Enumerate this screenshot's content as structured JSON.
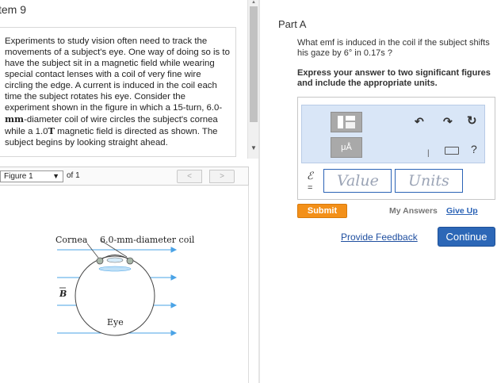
{
  "item": {
    "title": "tem 9"
  },
  "problem": {
    "line1": "Experiments to study vision often need to track the movements of a subject's eye. One way of doing so is to have the subject sit in a magnetic field while wearing special contact lenses with a coil of very fine wire circling the edge. A current is induced in the coil each time the subject rotates his eye. Consider the experiment shown in the figure in which a 15-turn, 6.0-",
    "unit_mm": "mm",
    "line2": "-diameter coil of wire circles the subject's cornea while a 1.0",
    "unit_T": "T",
    "line3": " magnetic field is directed as shown. The subject begins by looking straight ahead."
  },
  "figure_nav": {
    "select_value": "Figure 1",
    "of_text": "of 1",
    "prev": "<",
    "next": ">"
  },
  "figure": {
    "cornea_label": "Cornea",
    "coil_label": "6.0-mm-diameter coil",
    "b_label": "B",
    "eye_label": "Eye"
  },
  "part": {
    "label": "Part A",
    "question": "What emf is induced in the coil if the subject shifts his gaze by 6° in 0.17s ?",
    "instruction": "Express your answer to two significant figures and include the appropriate units."
  },
  "answer": {
    "var_symbol": "ℰ",
    "eq": "=",
    "value_placeholder": "Value",
    "units_placeholder": "Units",
    "unit_tool": "μÅ"
  },
  "actions": {
    "submit": "Submit",
    "my_answers": "My Answers",
    "give_up": "Give Up",
    "feedback": "Provide Feedback",
    "continue": "Continue"
  },
  "colors": {
    "submit": "#f39019",
    "continue": "#2c67b7",
    "toolbar": "#d9e6f7",
    "field_arrows": "#4aa3e6"
  }
}
